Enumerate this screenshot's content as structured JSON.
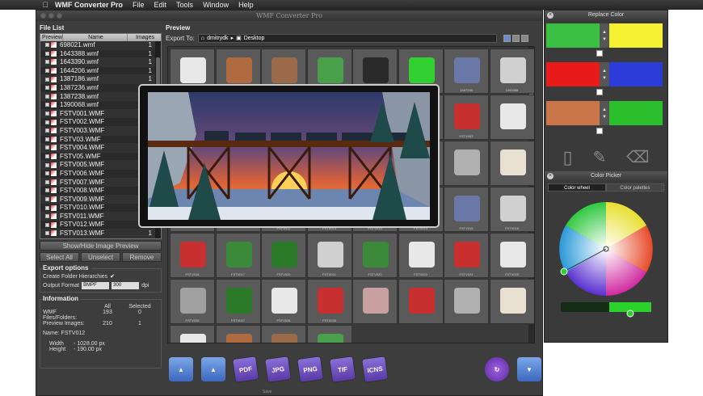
{
  "menubar": {
    "apple_icon": "apple-icon",
    "app": "WMF Converter Pro",
    "items": [
      "File",
      "Edit",
      "Tools",
      "Window",
      "Help"
    ]
  },
  "window": {
    "title": "WMF Converter Pro"
  },
  "file_list": {
    "section_label": "File List",
    "columns": [
      "Preview",
      "Name",
      "Images"
    ],
    "rows": [
      {
        "name": "698021.wmf",
        "images": "1"
      },
      {
        "name": "1643388.wmf",
        "images": "1"
      },
      {
        "name": "1643390.wmf",
        "images": "1"
      },
      {
        "name": "1644206.wmf",
        "images": "1"
      },
      {
        "name": "1387186.wmf",
        "images": "1"
      },
      {
        "name": "1387236.wmf",
        "images": "1"
      },
      {
        "name": "1387238.wmf",
        "images": "1"
      },
      {
        "name": "1390068.wmf",
        "images": "1"
      },
      {
        "name": "FSTV001.WMF",
        "images": "1"
      },
      {
        "name": "FSTV002.WMF",
        "images": "1"
      },
      {
        "name": "FSTV003.WMF",
        "images": "1"
      },
      {
        "name": "FSTV03.WMF",
        "images": "1"
      },
      {
        "name": "FSTV004.WMF",
        "images": "1"
      },
      {
        "name": "FSTV05.WMF",
        "images": "1"
      },
      {
        "name": "FSTV005.WMF",
        "images": "1"
      },
      {
        "name": "FSTV006.WMF",
        "images": "1"
      },
      {
        "name": "FSTV007.WMF",
        "images": "1"
      },
      {
        "name": "FSTV008.WMF",
        "images": "1"
      },
      {
        "name": "FSTV009.WMF",
        "images": "1"
      },
      {
        "name": "FSTV010.WMF",
        "images": "1"
      },
      {
        "name": "FSTV011.WMF",
        "images": "1"
      },
      {
        "name": "FSTV012.WMF",
        "images": "1"
      },
      {
        "name": "FSTV013.WMF",
        "images": "1"
      }
    ]
  },
  "buttons": {
    "show_hide": "Show/Hide Image Preview",
    "select_all": "Select All",
    "unselect": "Unselect",
    "remove": "Remove"
  },
  "export_options": {
    "section_label": "Export options",
    "create_folder": "Create Folder Hierarchies",
    "output_format_label": "Output Format",
    "format": "BMPF",
    "dpi_value": "300",
    "dpi_unit": "dpi"
  },
  "information": {
    "section_label": "Information",
    "col_all": "All",
    "col_selected": "Selected",
    "row1_label": "WMF Files/Folders:",
    "row1_all": "193",
    "row1_sel": "0",
    "row2_label": "Preview Images:",
    "row2_all": "210",
    "row2_sel": "1",
    "name": "Name: FSTV012",
    "width_label": "Width",
    "width_value": "- 1028.00 px",
    "height_label": "Height",
    "height_value": "- 190.00 px"
  },
  "preview": {
    "section_label": "Preview",
    "export_to": "Export To:",
    "path": [
      "dmitrydk",
      "Desktop"
    ]
  },
  "grid_labels": [
    "",
    "",
    "",
    "",
    "",
    "",
    "1387236",
    "1390068",
    "",
    "",
    "",
    "",
    "",
    "FSTV002",
    "FSTV003",
    "",
    "",
    "",
    "",
    "",
    "FSTV005",
    "",
    "",
    "",
    "",
    "",
    "FSTV012",
    "FSTV013",
    "FSTV013",
    "FSTV014",
    "FSTV015",
    "FSTV016",
    "FSTV018",
    "FSTV017",
    "FSTV020",
    "FSTV021",
    "FSTV022",
    "FSTV023",
    "FSTV024",
    "FSTV025",
    "FSTV026",
    "FSTV027",
    "FSTV028",
    "FSTV030",
    "",
    "",
    "",
    "",
    "",
    "",
    "",
    ""
  ],
  "toolbar": {
    "formats": [
      "PDF",
      "JPG",
      "PNG",
      "TIF",
      "ICNS"
    ],
    "save_label": "Save"
  },
  "replace_color": {
    "title": "Replace Color",
    "pairs": [
      {
        "from": "#3cc043",
        "to": "#f4f232"
      },
      {
        "from": "#e81a1a",
        "to": "#2b3cd9"
      },
      {
        "from": "#c9774a",
        "to": "#2bc02b"
      }
    ]
  },
  "color_picker": {
    "title": "Color Picker",
    "tab_wheel": "Color wheel",
    "tab_palettes": "Color palettes",
    "current_color": "#2bd22b"
  }
}
